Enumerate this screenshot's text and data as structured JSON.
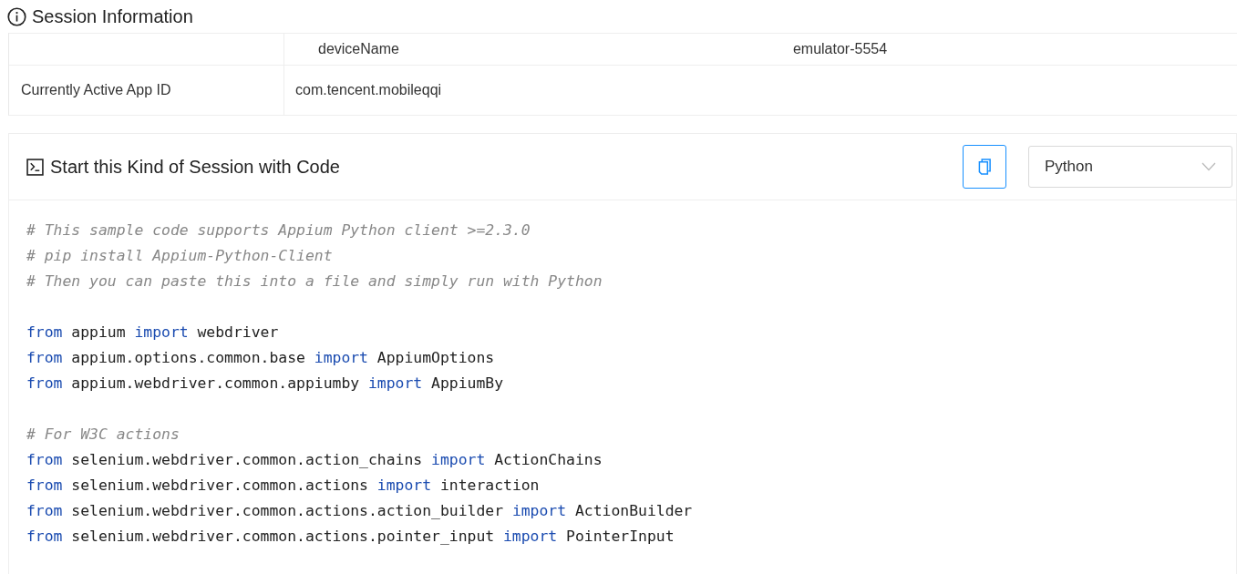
{
  "header": {
    "title": "Session Information"
  },
  "table": {
    "rows": [
      {
        "key": "deviceName",
        "value": "emulator-5554",
        "kind": "nested"
      },
      {
        "label": "Currently Active App ID",
        "value": "com.tencent.mobileqqi",
        "kind": "simple"
      }
    ]
  },
  "code_panel": {
    "title": "Start this Kind of Session with Code",
    "language": "Python",
    "lines": [
      {
        "kind": "code",
        "tokens": [
          {
            "kind": "comment",
            "text": "# This sample code supports Appium Python client >=2.3.0"
          }
        ]
      },
      {
        "kind": "code",
        "tokens": [
          {
            "kind": "comment",
            "text": "# pip install Appium-Python-Client"
          }
        ]
      },
      {
        "kind": "code",
        "tokens": [
          {
            "kind": "comment",
            "text": "# Then you can paste this into a file and simply run with Python"
          }
        ]
      },
      {
        "kind": "blank"
      },
      {
        "kind": "code",
        "tokens": [
          {
            "kind": "keyword",
            "text": "from"
          },
          {
            "kind": "plain",
            "text": "appium"
          },
          {
            "kind": "keyword",
            "text": "import"
          },
          {
            "kind": "plain",
            "text": "webdriver"
          }
        ]
      },
      {
        "kind": "code",
        "tokens": [
          {
            "kind": "keyword",
            "text": "from"
          },
          {
            "kind": "plain",
            "text": "appium.options.common.base"
          },
          {
            "kind": "keyword",
            "text": "import"
          },
          {
            "kind": "plain",
            "text": "AppiumOptions"
          }
        ]
      },
      {
        "kind": "code",
        "tokens": [
          {
            "kind": "keyword",
            "text": "from"
          },
          {
            "kind": "plain",
            "text": "appium.webdriver.common.appiumby"
          },
          {
            "kind": "keyword",
            "text": "import"
          },
          {
            "kind": "plain",
            "text": "AppiumBy"
          }
        ]
      },
      {
        "kind": "blank"
      },
      {
        "kind": "code",
        "tokens": [
          {
            "kind": "comment",
            "text": "# For W3C actions"
          }
        ]
      },
      {
        "kind": "code",
        "tokens": [
          {
            "kind": "keyword",
            "text": "from"
          },
          {
            "kind": "plain",
            "text": "selenium.webdriver.common.action_chains"
          },
          {
            "kind": "keyword",
            "text": "import"
          },
          {
            "kind": "plain",
            "text": "ActionChains"
          }
        ]
      },
      {
        "kind": "code",
        "tokens": [
          {
            "kind": "keyword",
            "text": "from"
          },
          {
            "kind": "plain",
            "text": "selenium.webdriver.common.actions"
          },
          {
            "kind": "keyword",
            "text": "import"
          },
          {
            "kind": "plain",
            "text": "interaction"
          }
        ]
      },
      {
        "kind": "code",
        "tokens": [
          {
            "kind": "keyword",
            "text": "from"
          },
          {
            "kind": "plain",
            "text": "selenium.webdriver.common.actions.action_builder"
          },
          {
            "kind": "keyword",
            "text": "import"
          },
          {
            "kind": "plain",
            "text": "ActionBuilder"
          }
        ]
      },
      {
        "kind": "code",
        "tokens": [
          {
            "kind": "keyword",
            "text": "from"
          },
          {
            "kind": "plain",
            "text": "selenium.webdriver.common.actions.pointer_input"
          },
          {
            "kind": "keyword",
            "text": "import"
          },
          {
            "kind": "plain",
            "text": "PointerInput"
          }
        ]
      }
    ]
  }
}
